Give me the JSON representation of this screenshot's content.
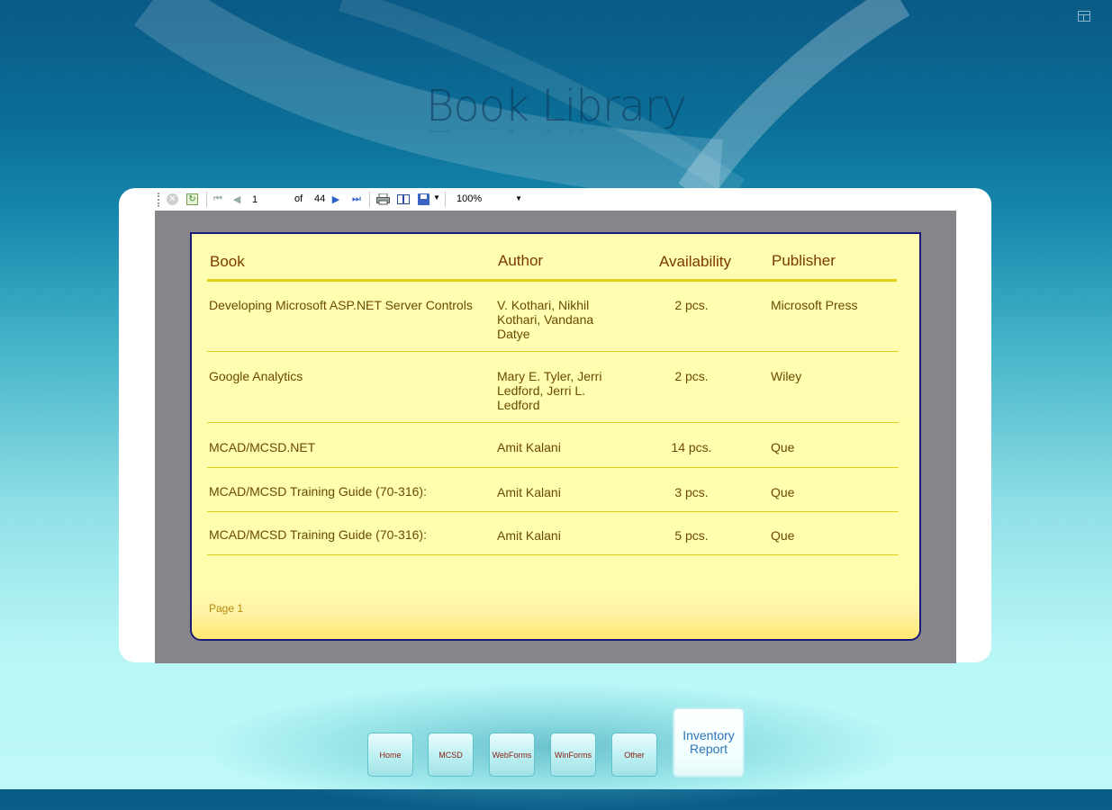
{
  "app": {
    "title": "Book Library"
  },
  "toolbar": {
    "current_page": "1",
    "of_label": "of",
    "total_pages": "44",
    "zoom": "100%"
  },
  "report": {
    "headers": {
      "book": "Book",
      "author": "Author",
      "availability": "Availability",
      "publisher": "Publisher"
    },
    "rows": [
      {
        "book": "Developing Microsoft ASP.NET Server Controls",
        "author": [
          "V. Kothari, Nikhil",
          "Kothari, Vandana",
          "Datye"
        ],
        "availability": "2 pcs.",
        "publisher": "Microsoft Press"
      },
      {
        "book": "Google Analytics",
        "author": [
          "Mary E. Tyler, Jerri",
          "Ledford, Jerri L.",
          "Ledford"
        ],
        "availability": "2 pcs.",
        "publisher": "Wiley"
      },
      {
        "book": "MCAD/MCSD.NET",
        "author": [
          "Amit Kalani"
        ],
        "availability": "14 pcs.",
        "publisher": "Que"
      },
      {
        "book": "MCAD/MCSD Training Guide (70-316):",
        "author": [
          "Amit Kalani"
        ],
        "availability": "3 pcs.",
        "publisher": "Que"
      },
      {
        "book": "MCAD/MCSD Training Guide (70-316):",
        "author": [
          "Amit Kalani"
        ],
        "availability": "5 pcs.",
        "publisher": "Que"
      }
    ],
    "footer": "Page 1"
  },
  "nav": {
    "home": "Home",
    "mcsd": "MCSD",
    "webforms": "WebForms",
    "winforms": "WinForms",
    "other": "Other",
    "inventory_line1": "Inventory",
    "inventory_line2": "Report"
  },
  "icons": {
    "stop": "stop-icon",
    "refresh": "refresh-icon",
    "first": "first-page-icon",
    "prev": "previous-page-icon",
    "next": "next-page-icon",
    "last": "last-page-icon",
    "print": "print-icon",
    "layout": "print-layout-icon",
    "export": "export-save-icon",
    "window": "window-layout-icon"
  },
  "colors": {
    "report_bg": "#fffdb0",
    "header_text": "#7a3a00",
    "rule": "#e4cf1a",
    "accent_nav": "#2a74b8"
  }
}
